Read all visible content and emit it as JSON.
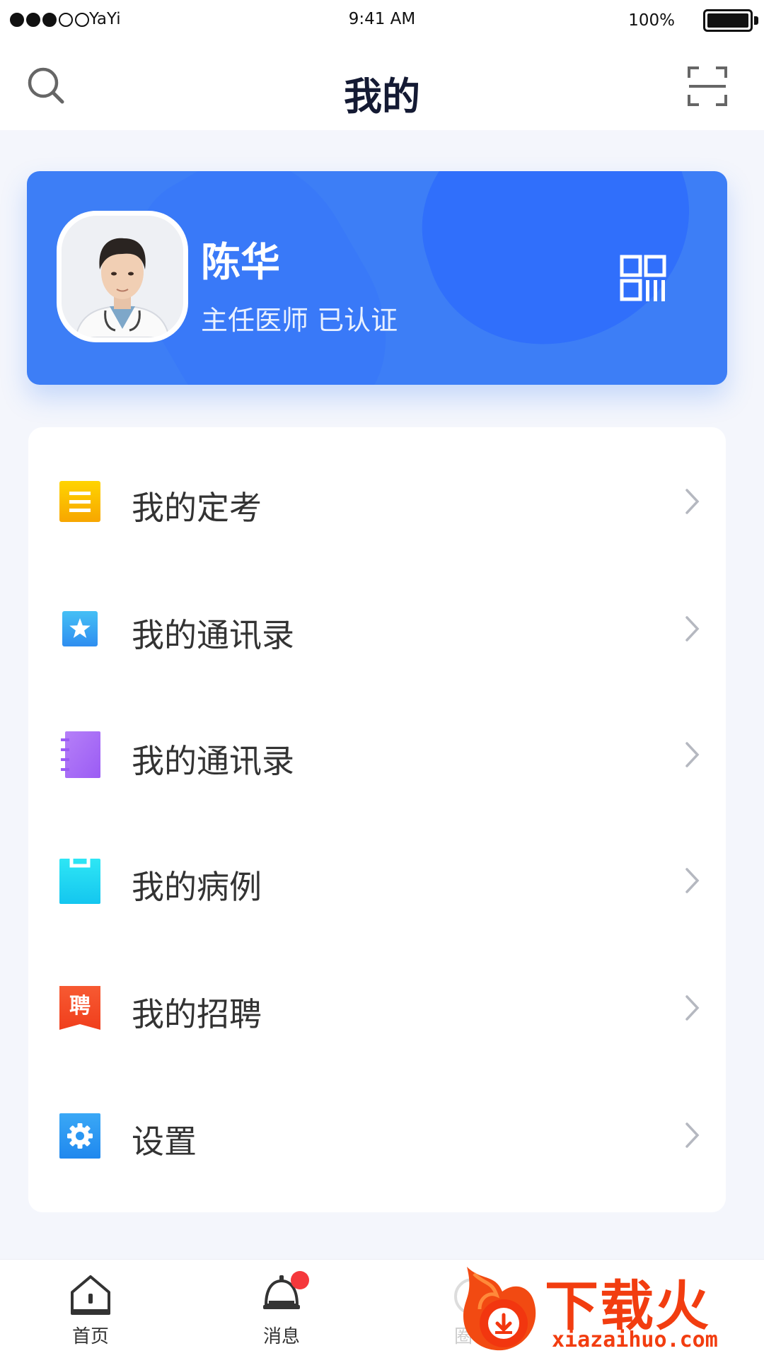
{
  "status_bar": {
    "carrier": "YaYi",
    "time": "9:41 AM",
    "battery": "100%"
  },
  "nav": {
    "title": "我的",
    "left_icon": "search-icon",
    "right_icon": "scan-icon"
  },
  "profile": {
    "name": "陈华",
    "title": "主任医师 已认证",
    "card_color": "#3d7ef6"
  },
  "menu": {
    "items": [
      {
        "label": "我的定考",
        "icon": "exam-icon",
        "color": "#f7b500"
      },
      {
        "label": "我的通讯录",
        "icon": "star-icon",
        "color": "#39a5f3"
      },
      {
        "label": "我的通讯录",
        "icon": "notebook-icon",
        "color": "#a46cf6"
      },
      {
        "label": "我的病例",
        "icon": "clipboard-icon",
        "color": "#22d3f2"
      },
      {
        "label": "我的招聘",
        "icon": "recruit-icon",
        "color": "#f5512a",
        "glyph": "聘"
      },
      {
        "label": "设置",
        "icon": "gear-icon",
        "color": "#2e97f3"
      }
    ]
  },
  "tab_bar": {
    "tabs": [
      {
        "label": "首页",
        "icon": "home-icon"
      },
      {
        "label": "消息",
        "icon": "bell-icon"
      },
      {
        "label": "圈子",
        "icon": "circle-icon"
      }
    ]
  },
  "watermark": {
    "text": "下载火",
    "url": "xiazaihuo.com"
  }
}
